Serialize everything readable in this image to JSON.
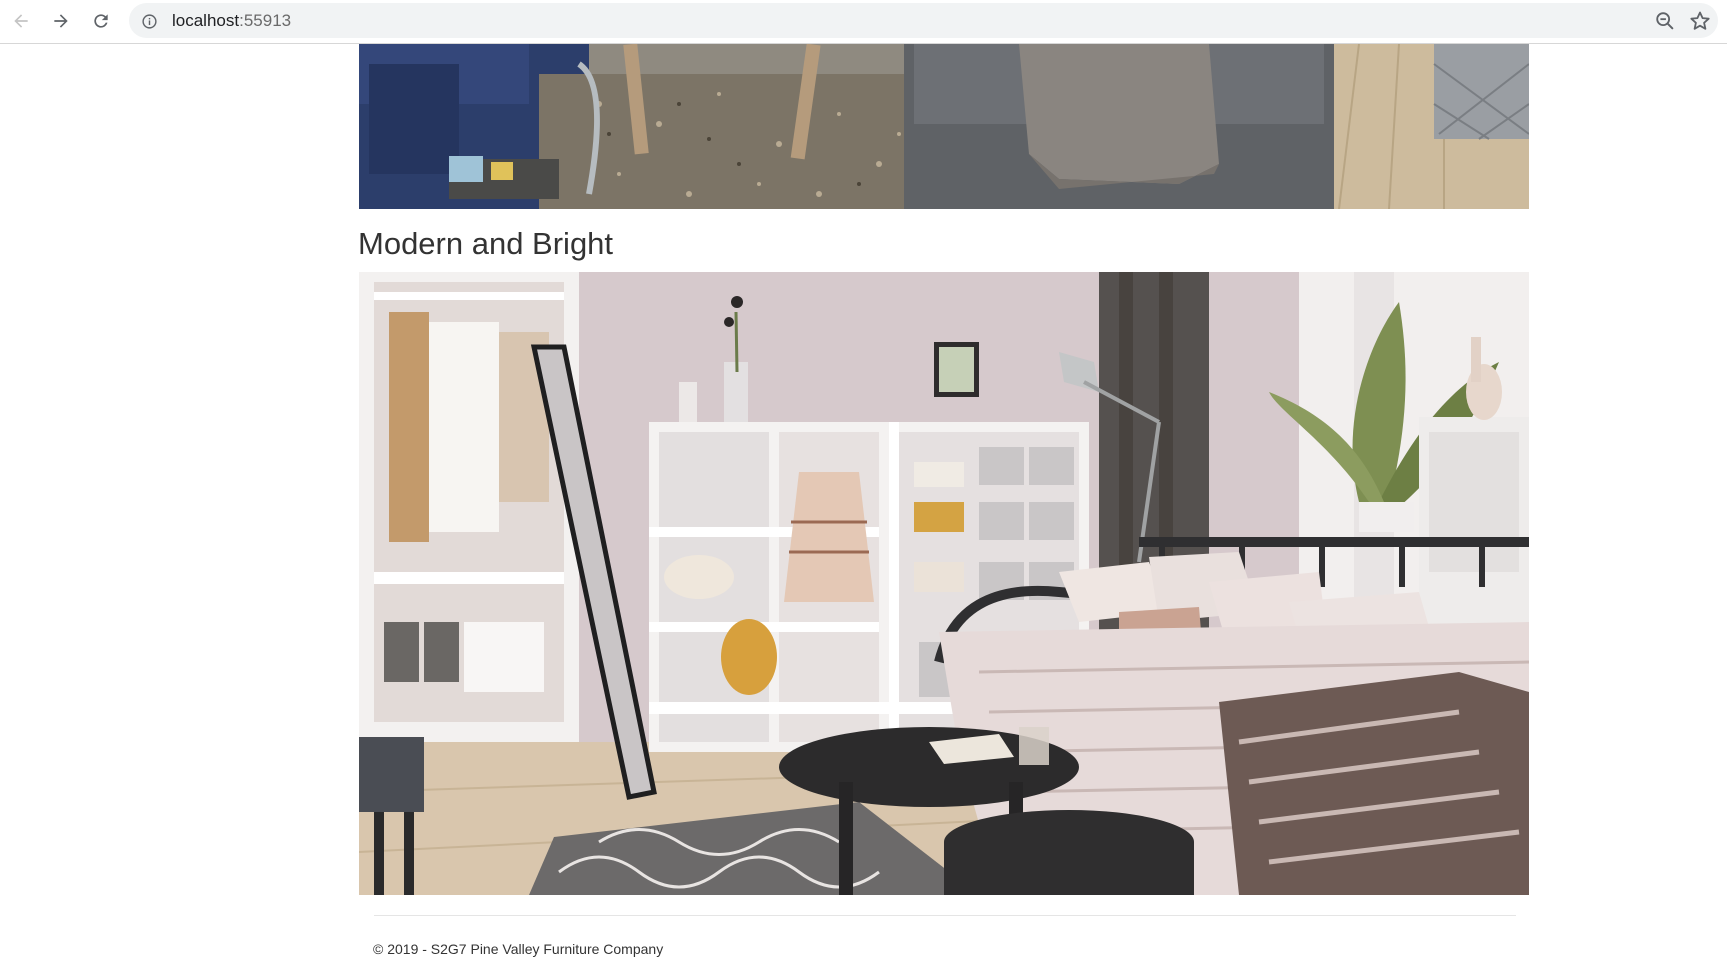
{
  "browser": {
    "url_host": "localhost",
    "url_port": ":55913",
    "icons": {
      "back": "arrow-left-icon",
      "forward": "arrow-right-icon",
      "reload": "reload-icon",
      "site_info": "info-icon",
      "zoom": "zoom-out-icon",
      "bookmark": "star-icon"
    }
  },
  "main": {
    "images": [
      {
        "name": "living-room-photo",
        "description_colors": [
          "#2b3f6e",
          "#6b6661",
          "#c9b79b"
        ]
      },
      {
        "name": "bedroom-photo",
        "description_colors": [
          "#d9cdd0",
          "#ffffff",
          "#2e2e30"
        ]
      }
    ],
    "section_title": "Modern and Bright"
  },
  "footer": {
    "copyright": "© 2019 - S2G7 Pine Valley Furniture Company"
  }
}
